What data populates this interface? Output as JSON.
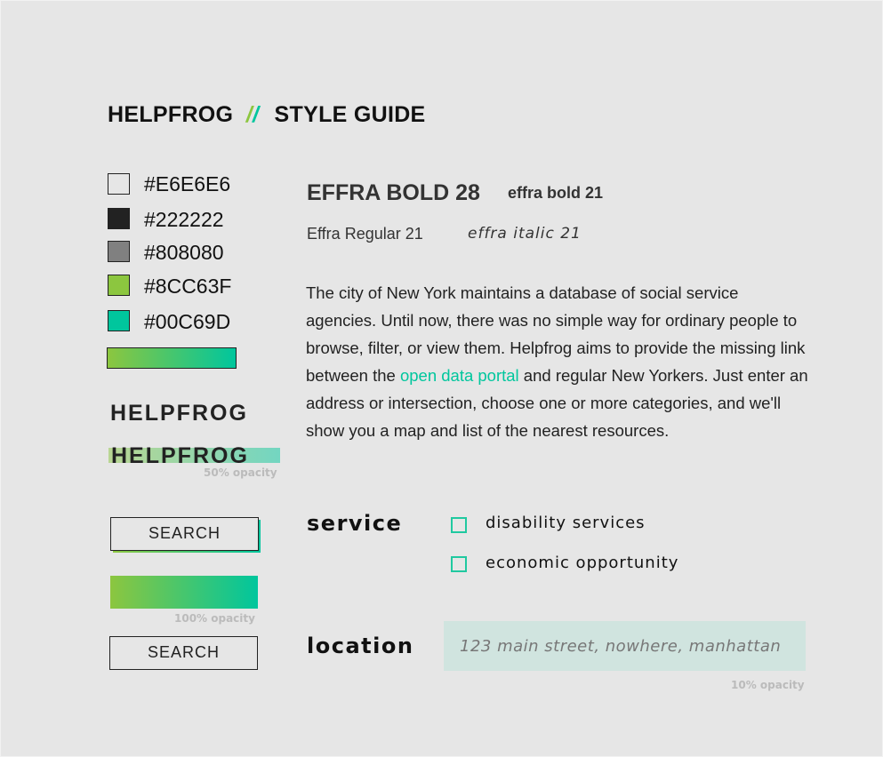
{
  "header": {
    "brand": "HELPFROG",
    "sep1": "/",
    "sep2": "/",
    "subtitle": "STYLE GUIDE"
  },
  "palette": [
    {
      "label": "#E6E6E6",
      "color": "#E6E6E6"
    },
    {
      "label": "#222222",
      "color": "#222222"
    },
    {
      "label": "#808080",
      "color": "#808080"
    },
    {
      "label": "#8CC63F",
      "color": "#8CC63F"
    },
    {
      "label": "#00C69D",
      "color": "#00C69D"
    }
  ],
  "logos": {
    "plain": "HELPFROG",
    "highlighted": "HELPFROG",
    "highlight_note": "50% opacity"
  },
  "buttons": {
    "search1": "SEARCH",
    "gradient_note": "100% opacity",
    "search2": "SEARCH"
  },
  "type": {
    "bold28": "EFFRA BOLD 28",
    "bold21": "effra bold 21",
    "regular21": "Effra Regular 21",
    "italic21": "effra italic 21"
  },
  "paragraph": {
    "before": "The city of New York maintains a database of social service agencies. Until now, there was no simple way for ordinary people to browse, filter, or view them. Helpfrog aims to provide the missing link between the ",
    "link": "open data portal",
    "after": " and regular New Yorkers. Just enter an address or intersection, choose one or more categories, and we'll show you a map and list of the nearest resources."
  },
  "service": {
    "label": "service",
    "options": [
      "disability services",
      "economic opportunity"
    ]
  },
  "location": {
    "label": "location",
    "placeholder": "123 main street, nowhere, manhattan",
    "note": "10% opacity"
  }
}
